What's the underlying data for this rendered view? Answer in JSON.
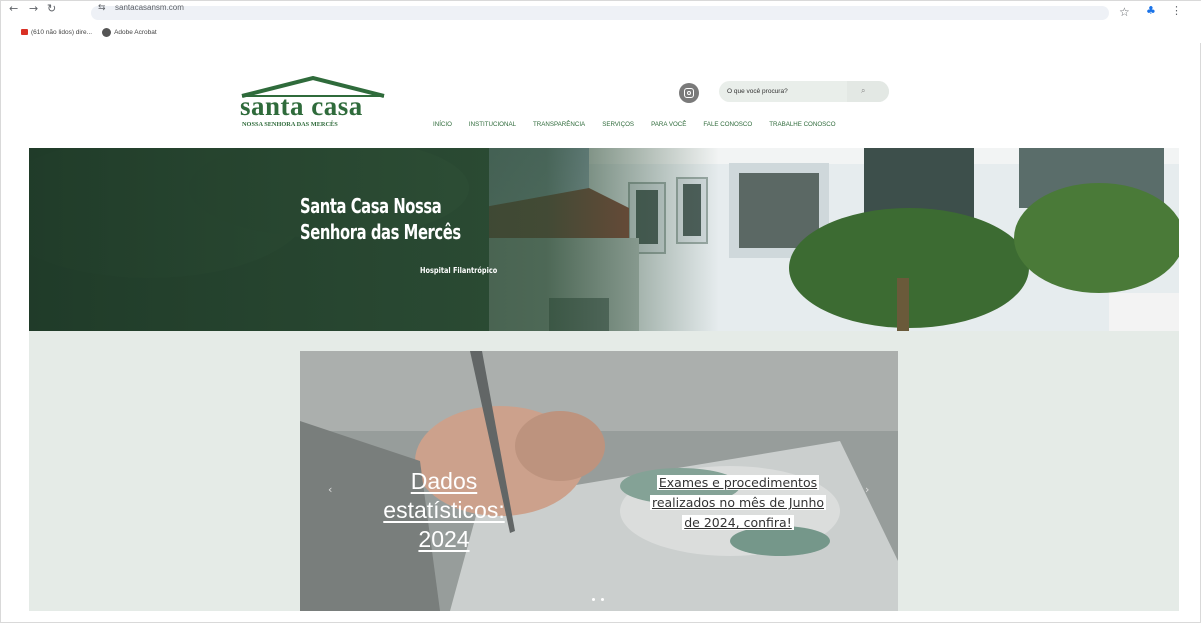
{
  "browser": {
    "url": "santacasansm.com",
    "nav_back": "←",
    "nav_forward": "→",
    "nav_reload": "↻",
    "site_info_icon": "⇆",
    "bookmark_icon": "☆",
    "extension_icon": "♣",
    "menu_icon": "⋮",
    "bookmarks": [
      {
        "label": "(610 não lidos) dire...",
        "icon": "gmail-icon"
      },
      {
        "label": "Adobe Acrobat",
        "icon": "acrobat-icon"
      }
    ]
  },
  "header": {
    "logo_main": "santa casa",
    "logo_sub": "NOSSA SENHORA DAS MERCÊS",
    "search_placeholder": "O que você procura?",
    "search_icon": "⌕",
    "nav": [
      "INÍCIO",
      "INSTITUCIONAL",
      "TRANSPARÊNCIA",
      "SERVIÇOS",
      "PARA VOCÊ",
      "FALE CONOSCO",
      "TRABALHE CONOSCO"
    ]
  },
  "hero": {
    "title_line1": "Santa Casa Nossa",
    "title_line2": "Senhora das Mercês",
    "subtitle": "Hospital Filantrópico"
  },
  "slider": {
    "title": "Dados estatísticos: 2024",
    "description": "Exames e procedimentos realizados no mês de Junho de 2024, confira!",
    "prev_arrow": "‹",
    "next_arrow": "›",
    "dot_count": 2
  },
  "colors": {
    "brand_green": "#2f6b3b",
    "content_bg": "#e5ebe7"
  }
}
